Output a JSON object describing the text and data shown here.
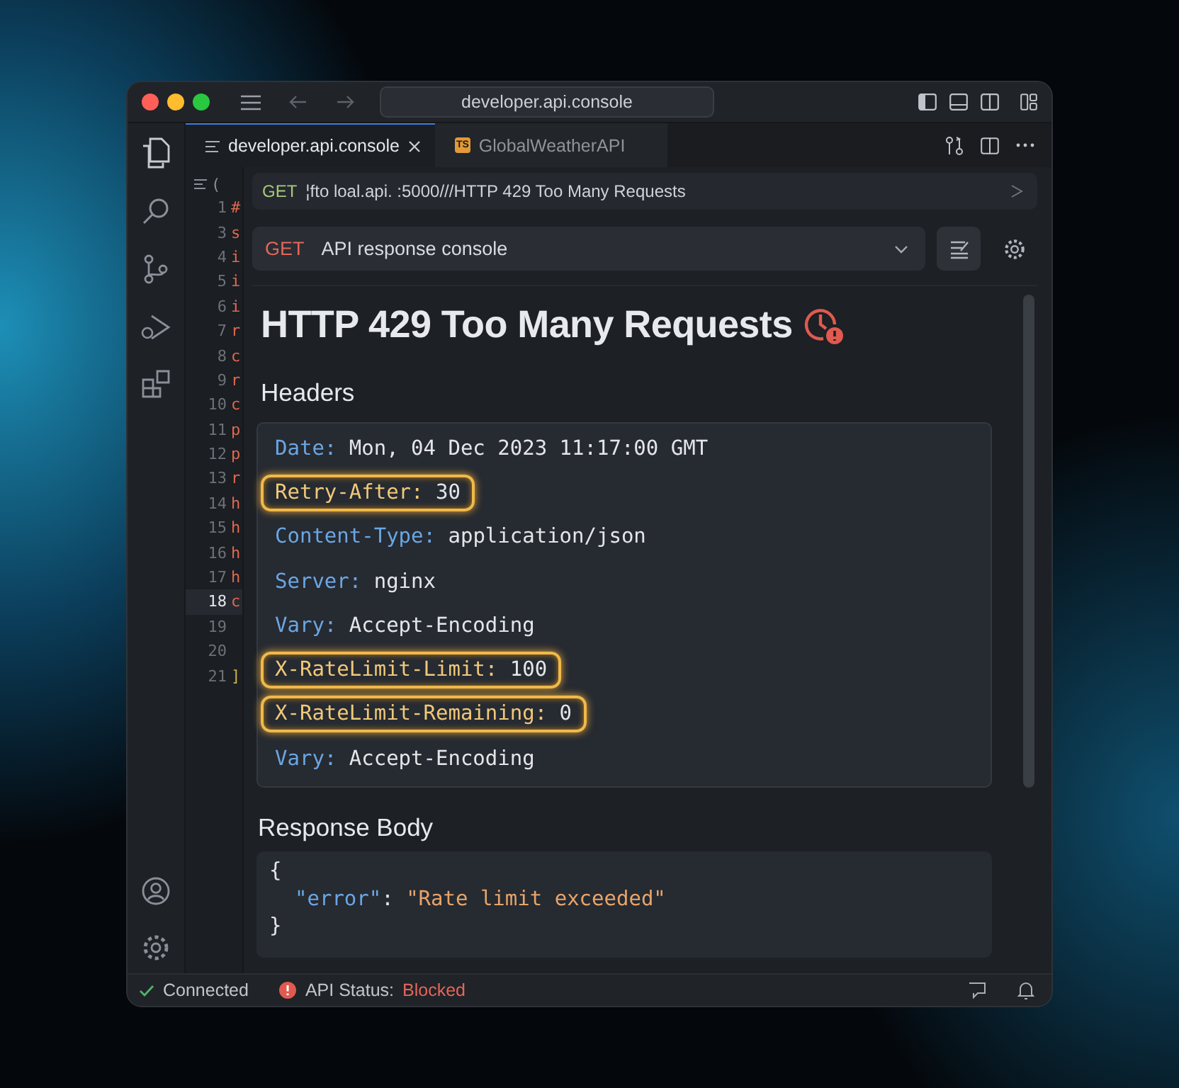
{
  "window": {
    "address": "developer.api.console"
  },
  "tabs": [
    {
      "label": "developer.api.console",
      "kind": "doc",
      "selected": true
    },
    {
      "label": "GlobalWeatherAPI",
      "kind": "ts",
      "badge": "TS",
      "selected": false
    }
  ],
  "editor": {
    "breadcrumb": "(",
    "lines": [
      {
        "number": "1",
        "text": "#",
        "selected": false
      },
      {
        "number": "3",
        "text": "s",
        "selected": false
      },
      {
        "number": "4",
        "text": "i",
        "selected": false
      },
      {
        "number": "5",
        "text": "i",
        "selected": false
      },
      {
        "number": "6",
        "text": "i",
        "selected": false
      },
      {
        "number": "7",
        "text": "r",
        "selected": false
      },
      {
        "number": "8",
        "text": "c",
        "selected": false
      },
      {
        "number": "9",
        "text": "r",
        "selected": false
      },
      {
        "number": "10",
        "text": "c",
        "selected": false
      },
      {
        "number": "11",
        "text": "p",
        "selected": false
      },
      {
        "number": "12",
        "text": "p",
        "selected": false
      },
      {
        "number": "13",
        "text": "r",
        "selected": false
      },
      {
        "number": "14",
        "text": "h",
        "selected": false
      },
      {
        "number": "15",
        "text": "h",
        "selected": false
      },
      {
        "number": "16",
        "text": "h",
        "selected": false
      },
      {
        "number": "17",
        "text": "h",
        "selected": false
      },
      {
        "number": "18",
        "text": "c",
        "selected": true
      },
      {
        "number": "19",
        "selected": false
      },
      {
        "number": "20",
        "selected": false
      },
      {
        "number": "21",
        "text": "]",
        "selected": false
      }
    ]
  },
  "url_bar": {
    "method": "GET",
    "url": "¦fto loal.api. :5000///HTTP 429 Too Many Requests"
  },
  "request": {
    "method": "GET",
    "label": "API response console"
  },
  "response": {
    "title": "HTTP 429 Too Many Requests",
    "headers_title": "Headers",
    "headers": [
      {
        "name": "Date:",
        "value": "Mon, 04 Dec 2023 11:17:00 GMT",
        "highlighted": false
      },
      {
        "name": "Retry-After:",
        "value": "30",
        "highlighted": true
      },
      {
        "name": "Content-Type:",
        "value": "application/json",
        "highlighted": false
      },
      {
        "name": "Server:",
        "value": "nginx",
        "highlighted": false
      },
      {
        "name": "Vary:",
        "value": "Accept-Encoding",
        "highlighted": false
      },
      {
        "name": "X-RateLimit-Limit:",
        "value": "100",
        "highlighted": true
      },
      {
        "name": "X-RateLimit-Remaining:",
        "value": "0",
        "highlighted": true
      },
      {
        "name": "Vary:",
        "value": "Accept-Encoding",
        "highlighted": false
      }
    ],
    "body_title": "Response Body",
    "body": {
      "open": "{",
      "key": "\"error\"",
      "colon": ":",
      "value": "\"Rate limit exceeded\"",
      "close": "}"
    }
  },
  "status_bar": {
    "connection": "Connected",
    "api_status_label": "API Status:",
    "api_status": "Blocked"
  }
}
